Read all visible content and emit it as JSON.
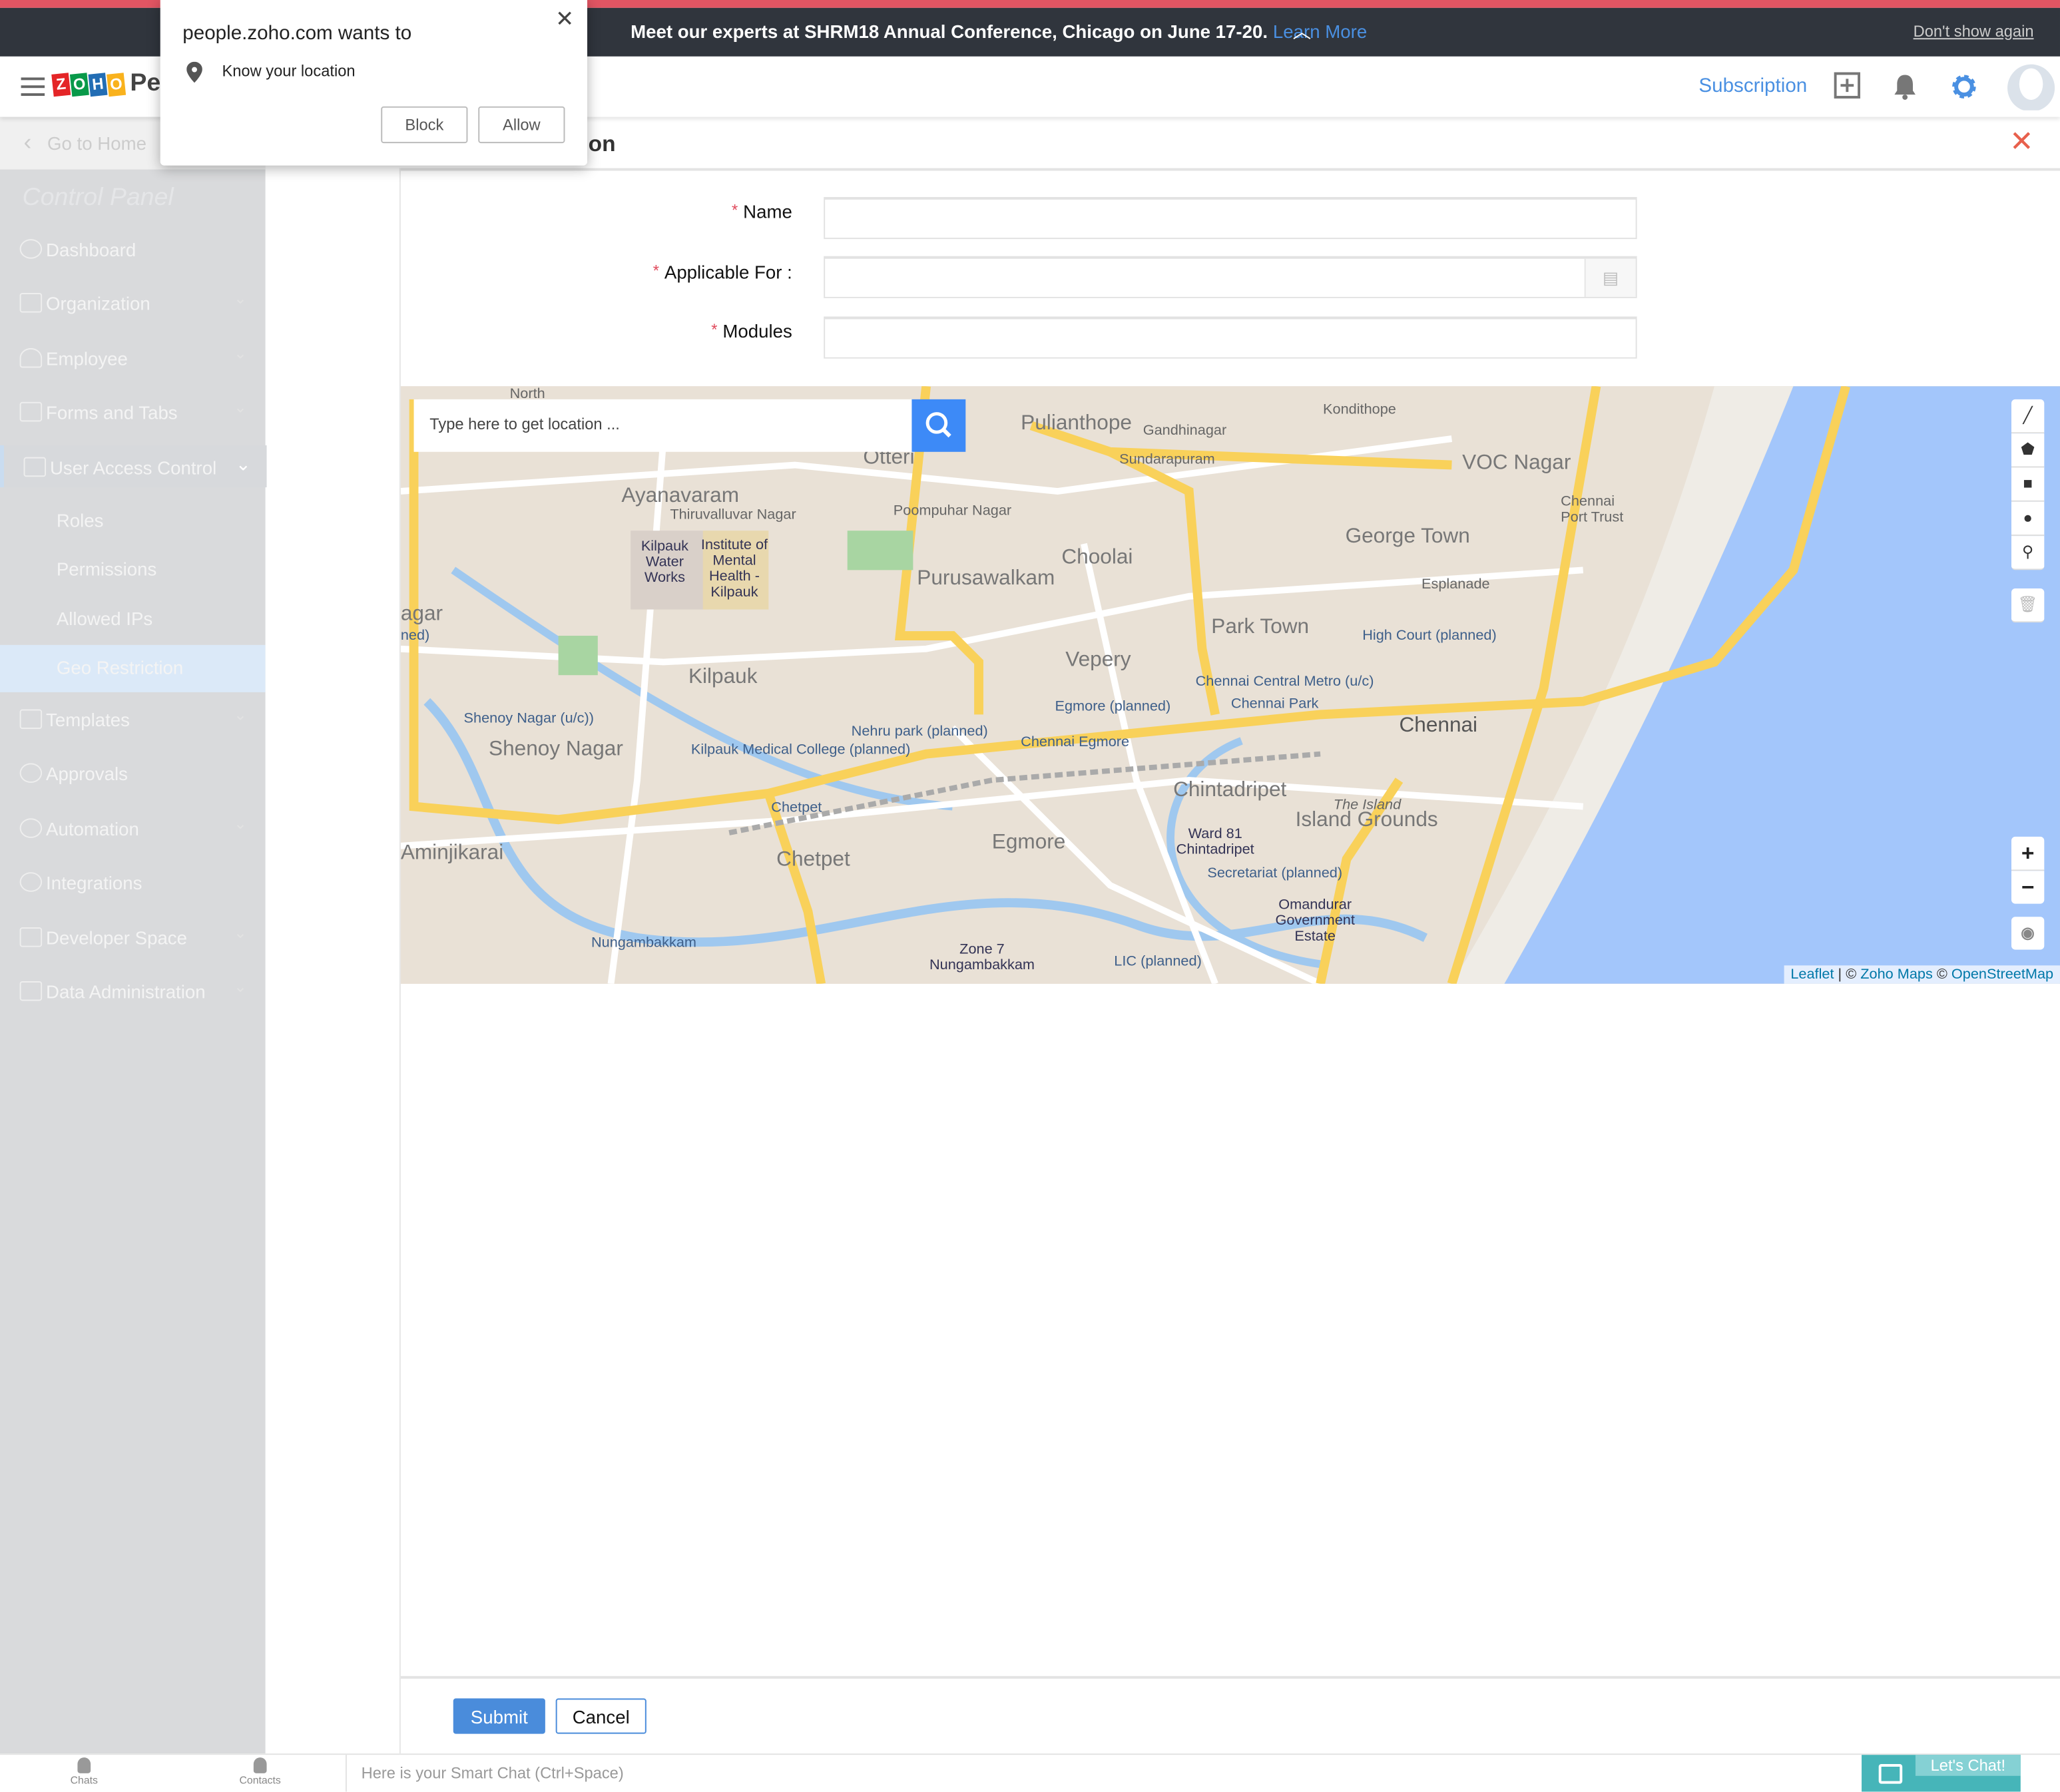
{
  "banner": {
    "message": "Meet our experts at SHRM18 Annual Conference, Chicago on June 17-20.",
    "learn_more": "Learn More",
    "dont_show": "Don't show again"
  },
  "header": {
    "logo_letters": [
      "Z",
      "O",
      "H",
      "O"
    ],
    "logo_product": "People",
    "subscription": "Subscription"
  },
  "popup": {
    "title": "people.zoho.com wants to",
    "request": "Know your location",
    "block": "Block",
    "allow": "Allow"
  },
  "sidebar": {
    "go_home": "Go to Home",
    "section_title": "Control Panel",
    "items": [
      {
        "label": "Dashboard"
      },
      {
        "label": "Organization"
      },
      {
        "label": "Employee"
      },
      {
        "label": "Forms and Tabs"
      },
      {
        "label": "User Access Control"
      },
      {
        "label": "Templates"
      },
      {
        "label": "Approvals"
      },
      {
        "label": "Automation"
      },
      {
        "label": "Integrations"
      },
      {
        "label": "Developer Space"
      },
      {
        "label": "Data Administration"
      }
    ],
    "subitems": [
      {
        "label": "Roles"
      },
      {
        "label": "Permissions"
      },
      {
        "label": "Allowed IPs"
      },
      {
        "label": "Geo Restriction",
        "active": true
      }
    ]
  },
  "page": {
    "title": "Geo Restriction",
    "form": {
      "name_label": "Name",
      "applicable_label": "Applicable For :",
      "modules_label": "Modules",
      "required_mark": "*"
    },
    "map": {
      "search_placeholder": "Type here to get location ...",
      "attribution": {
        "leaflet": "Leaflet",
        "zoho": "Zoho Maps",
        "osm": "OpenStreetMap",
        "sep": " | © ",
        "copy": " © "
      },
      "labels": [
        "North",
        "Pulianthope",
        "Gandhinagar",
        "Sundarapuram",
        "Kondithope",
        "VOC Nagar",
        "Chennai Port Trust",
        "Otteri",
        "Ayanavaram",
        "Thiruvalluvar Nagar",
        "Poompuhar Nagar",
        "Kilpauk Water Works",
        "Institute of Mental Health - Kilpauk",
        "Purusawalkam",
        "Choolai",
        "George Town",
        "Esplanade",
        "Park Town",
        "High Court (planned)",
        "Vepery",
        "Kilpauk",
        "Chennai Central Metro (u/c)",
        "Chennai Park",
        "Egmore (planned)",
        "Shenoy Nagar (u/c))",
        "Nehru park (planned)",
        "Chennai",
        "Shenoy Nagar",
        "Kilpauk Medical College (planned)",
        "Chennai Egmore",
        "Chintadripet",
        "Chetpet",
        "The Island",
        "Island Grounds",
        "Ward 81 Chintadripet",
        "Egmore",
        "Aminjikarai",
        "Chetpet",
        "Secretariat (planned)",
        "Omandurar Government Estate",
        "Nungambakkam",
        "Zone 7 Nungambakkam",
        "LIC (planned)",
        "agar",
        "ned)"
      ],
      "zoom_in": "+",
      "zoom_out": "−"
    },
    "submit": "Submit",
    "cancel": "Cancel"
  },
  "bottom_bar": {
    "chats": "Chats",
    "contacts": "Contacts",
    "smart_chat": "Here is your Smart Chat (Ctrl+Space)",
    "lets_chat": "Let's Chat!"
  },
  "colors": {
    "accent": "#4a90e2",
    "banner": "#30353d",
    "alert": "#e25563",
    "sea": "#a3c6fb",
    "road": "#f9d15a"
  }
}
